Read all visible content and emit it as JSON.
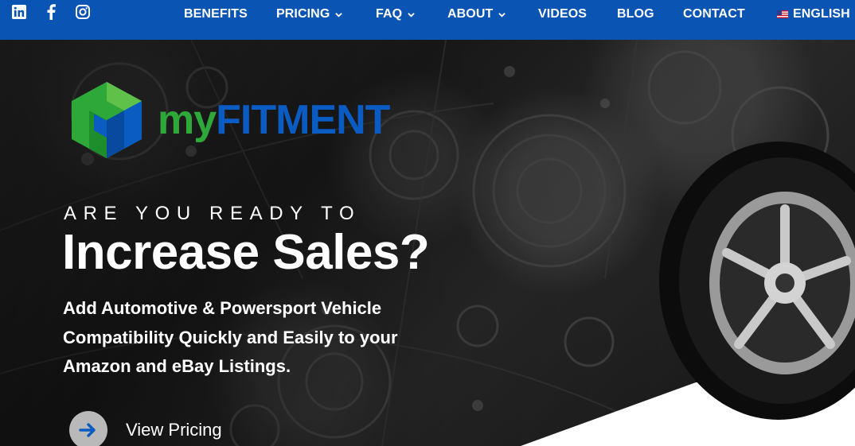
{
  "social": [
    {
      "icon": "linkedin-icon"
    },
    {
      "icon": "facebook-icon"
    },
    {
      "icon": "instagram-icon"
    }
  ],
  "nav": {
    "benefits": "BENEFITS",
    "pricing": "PRICING",
    "faq": "FAQ",
    "about": "ABOUT",
    "videos": "VIDEOS",
    "blog": "BLOG",
    "contact": "CONTACT",
    "language": "ENGLISH"
  },
  "brand": {
    "logo_my": "my",
    "logo_fitment": "FITMENT",
    "green": "#2fa83a",
    "blue": "#0a5cc2"
  },
  "hero": {
    "eyebrow": "ARE YOU READY TO",
    "headline": "Increase Sales?",
    "subtitle": "Add Automotive & Powersport Vehicle Compatibility Quickly and Easily to your Amazon and eBay Listings.",
    "cta_label": "View Pricing"
  },
  "colors": {
    "nav_bg": "#0a55b4",
    "cta_circle": "#b9b9b9",
    "cta_arrow": "#0a5cc2"
  }
}
